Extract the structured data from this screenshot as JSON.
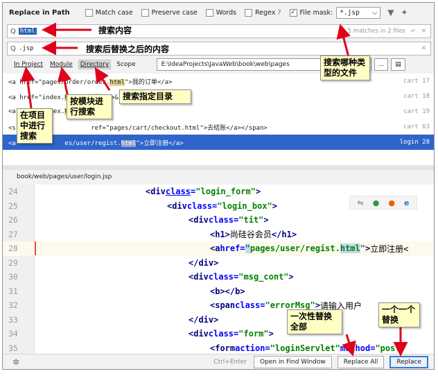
{
  "dialog": {
    "title": "Replace in Path",
    "options": {
      "match_case": "Match case",
      "preserve_case": "Preserve case",
      "words": "Words",
      "regex": "Regex",
      "regex_help": "?",
      "file_mask": "File mask:",
      "file_mask_checked": true,
      "file_mask_value": "*.jsp"
    },
    "search": {
      "value": "html",
      "matches": "5 matches in 2 files"
    },
    "replace": {
      "value": ".jsp"
    },
    "scope": {
      "tabs": [
        "In Project",
        "Module",
        "Directory",
        "Scope"
      ],
      "active_tab": "Directory",
      "directory": "E:\\IdeaProjects\\JavaWeb\\book\\web\\pages",
      "browse": "..."
    },
    "results": [
      {
        "prefix": "<a href=\"pages/order/order.",
        "match": "html",
        "suffix": "\">我的订单</a>",
        "file": "cart 17"
      },
      {
        "prefix": "<a href=\"index.",
        "match": "html",
        "suffix": "\">注销</a>&",
        "file": "cart 18"
      },
      {
        "prefix": "<a href=\"index.",
        "match": "html",
        "suffix": "\"",
        "file": "cart 19"
      },
      {
        "prefix": "<s",
        "match": "",
        "suffix": "\"ca                 ref=\"pages/cart/checkout.html\">去结账</a></span>",
        "file": "cart 63"
      },
      {
        "prefix": "<a             es/user/regist.",
        "match": "html",
        "suffix": "\">立即注册</a>",
        "file": "login 28"
      }
    ],
    "preview_path": "book/web/pages/user/login.jsp",
    "editor": {
      "line_numbers": [
        "24",
        "25",
        "26",
        "27",
        "28",
        "29",
        "30",
        "31",
        "32",
        "33",
        "34",
        "35"
      ]
    },
    "bottom": {
      "shortcut": "Ctrl+Enter",
      "open_in_find_window": "Open in Find Window",
      "replace_all": "Replace All",
      "replace": "Replace"
    }
  },
  "annotations": {
    "search_content": "搜索内容",
    "replace_content": "搜索后替换之后的内容",
    "file_types": "搜索哪种类型的文件",
    "search_dir": "搜索指定目录",
    "by_module": "按模块进行搜索",
    "in_project": "在项目中进行搜索",
    "replace_all_note": "一次性替换全部",
    "replace_one_note": "一个一个替换"
  },
  "colors": {
    "selection": "#2f65ca",
    "note_bg": "#ffffc4",
    "arrow": "#e0001b"
  }
}
